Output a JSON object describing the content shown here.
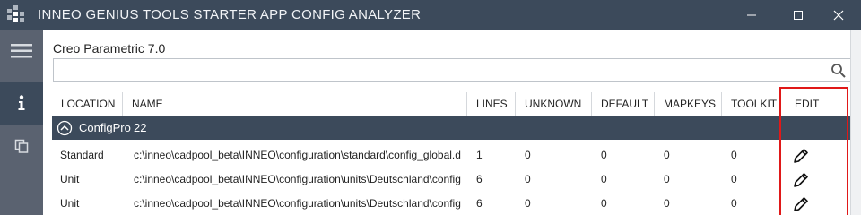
{
  "window": {
    "title": "INNEO GENIUS TOOLS STARTER APP CONFIG ANALYZER",
    "controls": [
      "minimize",
      "maximize",
      "close"
    ]
  },
  "sidebar": {
    "items": [
      {
        "icon": "hamburger-menu-icon",
        "active": false
      },
      {
        "icon": "info-icon",
        "active": true
      },
      {
        "icon": "copy-icon",
        "active": false
      }
    ]
  },
  "main": {
    "product": "Creo Parametric 7.0",
    "search": {
      "value": "",
      "placeholder": ""
    }
  },
  "table": {
    "columns": [
      "LOCATION",
      "NAME",
      "LINES",
      "UNKNOWN",
      "DEFAULT",
      "MAPKEYS",
      "TOOLKIT",
      "EDIT"
    ],
    "group": {
      "name": "ConfigPro",
      "count": "22",
      "expanded": true
    },
    "rows": [
      {
        "location": "Standard",
        "name": "c:\\inneo\\cadpool_beta\\INNEO\\configuration\\standard\\config_global.d",
        "lines": "1",
        "unknown": "0",
        "default": "0",
        "mapkeys": "0",
        "toolkit": "0"
      },
      {
        "location": "Unit",
        "name": "c:\\inneo\\cadpool_beta\\INNEO\\configuration\\units\\Deutschland\\config",
        "lines": "6",
        "unknown": "0",
        "default": "0",
        "mapkeys": "0",
        "toolkit": "0"
      },
      {
        "location": "Unit",
        "name": "c:\\inneo\\cadpool_beta\\INNEO\\configuration\\units\\Deutschland\\config",
        "lines": "6",
        "unknown": "0",
        "default": "0",
        "mapkeys": "0",
        "toolkit": "0"
      }
    ]
  },
  "colors": {
    "titlebar": "#3c4a5b",
    "sidebar": "#5a6270",
    "group_row": "#3c4a5b",
    "highlight": "#e01818"
  }
}
